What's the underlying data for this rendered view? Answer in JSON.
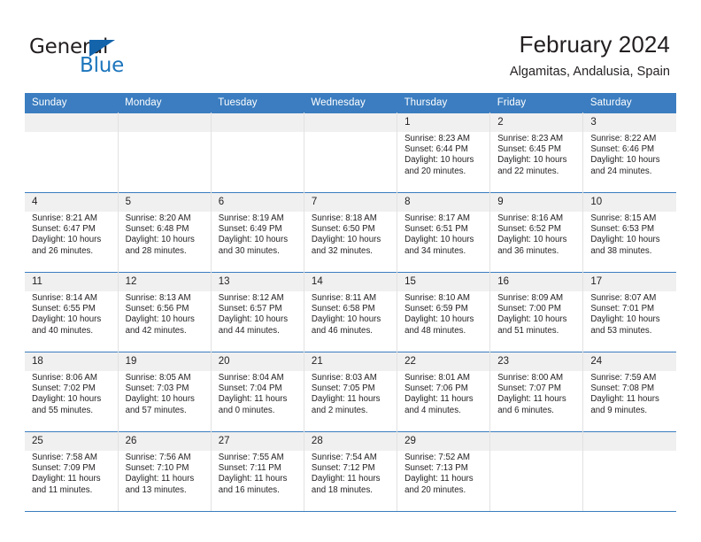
{
  "brand": {
    "name_top": "General",
    "name_bottom": "Blue",
    "accent_color": "#1c75bc",
    "triangle_color": "#1464ac"
  },
  "header": {
    "title": "February 2024",
    "subtitle": "Algamitas, Andalusia, Spain"
  },
  "calendar": {
    "header_bg": "#3b7dc0",
    "daynum_bg": "#f0f0f0",
    "weekday_headers": [
      "Sunday",
      "Monday",
      "Tuesday",
      "Wednesday",
      "Thursday",
      "Friday",
      "Saturday"
    ],
    "weeks": [
      [
        {
          "day": "",
          "lines": []
        },
        {
          "day": "",
          "lines": []
        },
        {
          "day": "",
          "lines": []
        },
        {
          "day": "",
          "lines": []
        },
        {
          "day": "1",
          "lines": [
            "Sunrise: 8:23 AM",
            "Sunset: 6:44 PM",
            "Daylight: 10 hours",
            "and 20 minutes."
          ]
        },
        {
          "day": "2",
          "lines": [
            "Sunrise: 8:23 AM",
            "Sunset: 6:45 PM",
            "Daylight: 10 hours",
            "and 22 minutes."
          ]
        },
        {
          "day": "3",
          "lines": [
            "Sunrise: 8:22 AM",
            "Sunset: 6:46 PM",
            "Daylight: 10 hours",
            "and 24 minutes."
          ]
        }
      ],
      [
        {
          "day": "4",
          "lines": [
            "Sunrise: 8:21 AM",
            "Sunset: 6:47 PM",
            "Daylight: 10 hours",
            "and 26 minutes."
          ]
        },
        {
          "day": "5",
          "lines": [
            "Sunrise: 8:20 AM",
            "Sunset: 6:48 PM",
            "Daylight: 10 hours",
            "and 28 minutes."
          ]
        },
        {
          "day": "6",
          "lines": [
            "Sunrise: 8:19 AM",
            "Sunset: 6:49 PM",
            "Daylight: 10 hours",
            "and 30 minutes."
          ]
        },
        {
          "day": "7",
          "lines": [
            "Sunrise: 8:18 AM",
            "Sunset: 6:50 PM",
            "Daylight: 10 hours",
            "and 32 minutes."
          ]
        },
        {
          "day": "8",
          "lines": [
            "Sunrise: 8:17 AM",
            "Sunset: 6:51 PM",
            "Daylight: 10 hours",
            "and 34 minutes."
          ]
        },
        {
          "day": "9",
          "lines": [
            "Sunrise: 8:16 AM",
            "Sunset: 6:52 PM",
            "Daylight: 10 hours",
            "and 36 minutes."
          ]
        },
        {
          "day": "10",
          "lines": [
            "Sunrise: 8:15 AM",
            "Sunset: 6:53 PM",
            "Daylight: 10 hours",
            "and 38 minutes."
          ]
        }
      ],
      [
        {
          "day": "11",
          "lines": [
            "Sunrise: 8:14 AM",
            "Sunset: 6:55 PM",
            "Daylight: 10 hours",
            "and 40 minutes."
          ]
        },
        {
          "day": "12",
          "lines": [
            "Sunrise: 8:13 AM",
            "Sunset: 6:56 PM",
            "Daylight: 10 hours",
            "and 42 minutes."
          ]
        },
        {
          "day": "13",
          "lines": [
            "Sunrise: 8:12 AM",
            "Sunset: 6:57 PM",
            "Daylight: 10 hours",
            "and 44 minutes."
          ]
        },
        {
          "day": "14",
          "lines": [
            "Sunrise: 8:11 AM",
            "Sunset: 6:58 PM",
            "Daylight: 10 hours",
            "and 46 minutes."
          ]
        },
        {
          "day": "15",
          "lines": [
            "Sunrise: 8:10 AM",
            "Sunset: 6:59 PM",
            "Daylight: 10 hours",
            "and 48 minutes."
          ]
        },
        {
          "day": "16",
          "lines": [
            "Sunrise: 8:09 AM",
            "Sunset: 7:00 PM",
            "Daylight: 10 hours",
            "and 51 minutes."
          ]
        },
        {
          "day": "17",
          "lines": [
            "Sunrise: 8:07 AM",
            "Sunset: 7:01 PM",
            "Daylight: 10 hours",
            "and 53 minutes."
          ]
        }
      ],
      [
        {
          "day": "18",
          "lines": [
            "Sunrise: 8:06 AM",
            "Sunset: 7:02 PM",
            "Daylight: 10 hours",
            "and 55 minutes."
          ]
        },
        {
          "day": "19",
          "lines": [
            "Sunrise: 8:05 AM",
            "Sunset: 7:03 PM",
            "Daylight: 10 hours",
            "and 57 minutes."
          ]
        },
        {
          "day": "20",
          "lines": [
            "Sunrise: 8:04 AM",
            "Sunset: 7:04 PM",
            "Daylight: 11 hours",
            "and 0 minutes."
          ]
        },
        {
          "day": "21",
          "lines": [
            "Sunrise: 8:03 AM",
            "Sunset: 7:05 PM",
            "Daylight: 11 hours",
            "and 2 minutes."
          ]
        },
        {
          "day": "22",
          "lines": [
            "Sunrise: 8:01 AM",
            "Sunset: 7:06 PM",
            "Daylight: 11 hours",
            "and 4 minutes."
          ]
        },
        {
          "day": "23",
          "lines": [
            "Sunrise: 8:00 AM",
            "Sunset: 7:07 PM",
            "Daylight: 11 hours",
            "and 6 minutes."
          ]
        },
        {
          "day": "24",
          "lines": [
            "Sunrise: 7:59 AM",
            "Sunset: 7:08 PM",
            "Daylight: 11 hours",
            "and 9 minutes."
          ]
        }
      ],
      [
        {
          "day": "25",
          "lines": [
            "Sunrise: 7:58 AM",
            "Sunset: 7:09 PM",
            "Daylight: 11 hours",
            "and 11 minutes."
          ]
        },
        {
          "day": "26",
          "lines": [
            "Sunrise: 7:56 AM",
            "Sunset: 7:10 PM",
            "Daylight: 11 hours",
            "and 13 minutes."
          ]
        },
        {
          "day": "27",
          "lines": [
            "Sunrise: 7:55 AM",
            "Sunset: 7:11 PM",
            "Daylight: 11 hours",
            "and 16 minutes."
          ]
        },
        {
          "day": "28",
          "lines": [
            "Sunrise: 7:54 AM",
            "Sunset: 7:12 PM",
            "Daylight: 11 hours",
            "and 18 minutes."
          ]
        },
        {
          "day": "29",
          "lines": [
            "Sunrise: 7:52 AM",
            "Sunset: 7:13 PM",
            "Daylight: 11 hours",
            "and 20 minutes."
          ]
        },
        {
          "day": "",
          "lines": []
        },
        {
          "day": "",
          "lines": []
        }
      ]
    ]
  }
}
